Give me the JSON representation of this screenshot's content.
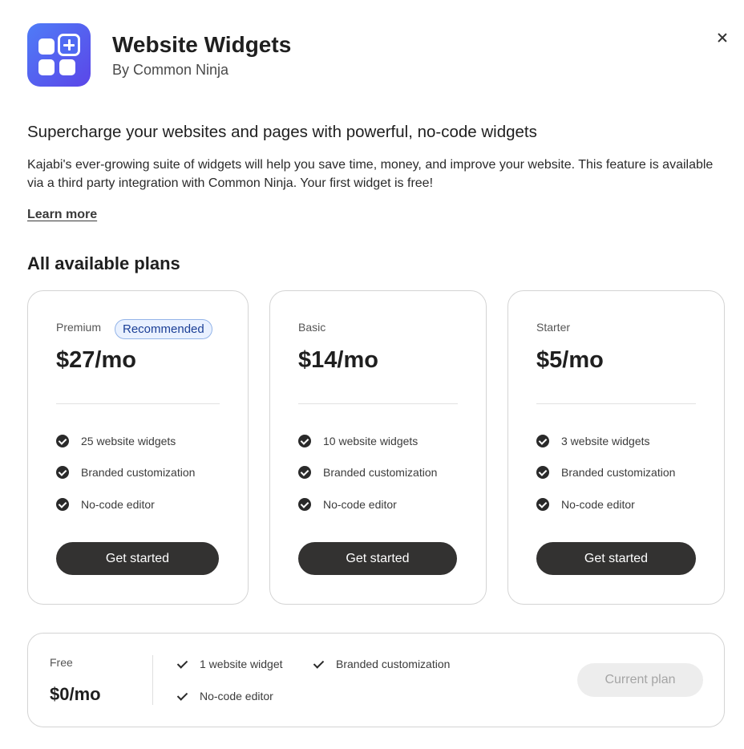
{
  "app": {
    "title": "Website Widgets",
    "author": "By Common Ninja",
    "icon": "widgets-grid-icon",
    "icon_gradient": [
      "#4f7cf7",
      "#5b46e8"
    ]
  },
  "close_icon": "close-icon",
  "intro": {
    "headline": "Supercharge your websites and pages with powerful, no-code widgets",
    "description": "Kajabi's ever-growing suite of widgets will help you save time, money, and improve your website. This feature is available via a third party integration with Common Ninja. Your first widget is free!",
    "learn_more": "Learn more"
  },
  "plans_heading": "All available plans",
  "plans": [
    {
      "tier": "Premium",
      "badge": "Recommended",
      "price": "$27/mo",
      "features": [
        "25 website widgets",
        "Branded customization",
        "No-code editor"
      ],
      "cta": "Get started"
    },
    {
      "tier": "Basic",
      "price": "$14/mo",
      "features": [
        "10 website widgets",
        "Branded customization",
        "No-code editor"
      ],
      "cta": "Get started"
    },
    {
      "tier": "Starter",
      "price": "$5/mo",
      "features": [
        "3 website widgets",
        "Branded customization",
        "No-code editor"
      ],
      "cta": "Get started"
    }
  ],
  "free_plan": {
    "tier": "Free",
    "price": "$0/mo",
    "features": [
      "1 website widget",
      "Branded customization",
      "No-code editor"
    ],
    "cta": "Current plan"
  },
  "colors": {
    "button_dark": "#333231",
    "badge_bg": "#e9f1ff",
    "badge_text": "#1b3f96",
    "disabled_bg": "#ededed"
  }
}
